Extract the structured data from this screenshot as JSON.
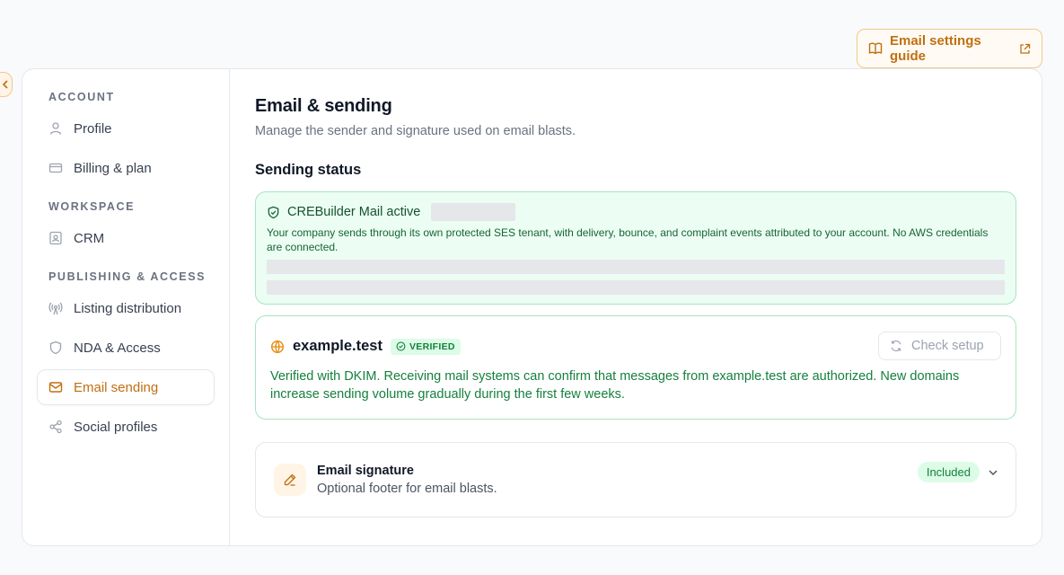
{
  "guide_button": {
    "label": "Email settings guide",
    "icon": "book-icon",
    "ext_icon": "external-link-icon"
  },
  "colors": {
    "accent": "#c06f10",
    "success": "#15803d",
    "success_bg": "#ecfdf3"
  },
  "sidebar": {
    "sections": [
      {
        "label": "ACCOUNT",
        "items": [
          {
            "label": "Profile",
            "icon": "user-icon"
          },
          {
            "label": "Billing & plan",
            "icon": "credit-card-icon"
          }
        ]
      },
      {
        "label": "WORKSPACE",
        "items": [
          {
            "label": "CRM",
            "icon": "contact-icon"
          }
        ]
      },
      {
        "label": "PUBLISHING & ACCESS",
        "items": [
          {
            "label": "Listing distribution",
            "icon": "broadcast-icon"
          },
          {
            "label": "NDA & Access",
            "icon": "shield-icon"
          },
          {
            "label": "Email sending",
            "icon": "mail-icon",
            "active": true
          },
          {
            "label": "Social profiles",
            "icon": "share-icon"
          }
        ]
      }
    ]
  },
  "main": {
    "title": "Email & sending",
    "subtitle": "Manage the sender and signature used on email blasts.",
    "sending_status": {
      "heading": "Sending status",
      "status_title": "CREBuilder Mail active",
      "status_desc": "Your company sends through its own protected SES tenant, with delivery, bounce, and complaint events attributed to your account. No AWS credentials are connected."
    },
    "domain": {
      "name": "example.test",
      "badge": "VERIFIED",
      "check_label": "Check setup",
      "desc": "Verified with DKIM. Receiving mail systems can confirm that messages from example.test are authorized. New domains increase sending volume gradually during the first few weeks."
    },
    "signature": {
      "title": "Email signature",
      "subtitle": "Optional footer for email blasts.",
      "badge": "Included"
    }
  }
}
